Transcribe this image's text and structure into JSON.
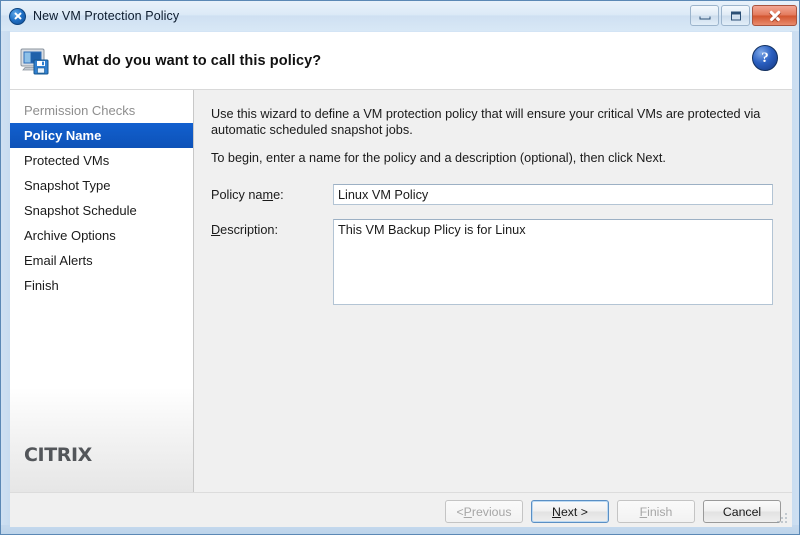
{
  "window": {
    "title": "New VM Protection Policy",
    "icon": "xen-circle-x-icon",
    "controls": {
      "minimize": "minimize-icon",
      "maximize": "maximize-icon",
      "close": "close-icon"
    }
  },
  "header": {
    "icon": "monitor-save-icon",
    "title": "What do you want to call this policy?",
    "help_label": "?"
  },
  "sidebar": {
    "items": [
      {
        "label": "Permission Checks",
        "state": "done"
      },
      {
        "label": "Policy Name",
        "state": "active"
      },
      {
        "label": "Protected VMs",
        "state": "normal"
      },
      {
        "label": "Snapshot Type",
        "state": "normal"
      },
      {
        "label": "Snapshot Schedule",
        "state": "normal"
      },
      {
        "label": "Archive Options",
        "state": "normal"
      },
      {
        "label": "Email Alerts",
        "state": "normal"
      },
      {
        "label": "Finish",
        "state": "normal"
      }
    ],
    "brand": "CITRIX"
  },
  "content": {
    "intro_paragraph_1": "Use this wizard to define a VM protection policy that will ensure your critical VMs are protected via automatic scheduled snapshot jobs.",
    "intro_paragraph_2": "To begin, enter a name for the policy and a description (optional), then click Next.",
    "policy_name": {
      "label_before": "Policy na",
      "label_accel": "m",
      "label_after": "e:",
      "value": "Linux VM Policy",
      "placeholder": ""
    },
    "description": {
      "label_accel": "D",
      "label_after": "escription:",
      "value": "This VM Backup Plicy is for Linux",
      "placeholder": ""
    }
  },
  "footer": {
    "buttons": [
      {
        "name": "previous",
        "before": "< ",
        "accel": "P",
        "after": "revious",
        "state": "disabled"
      },
      {
        "name": "next",
        "before": "",
        "accel": "N",
        "after": "ext >",
        "state": "default"
      },
      {
        "name": "finish",
        "before": "",
        "accel": "F",
        "after": "inish",
        "state": "disabled"
      },
      {
        "name": "cancel",
        "before": "",
        "accel": "",
        "after": "Cancel",
        "state": "normal"
      }
    ]
  },
  "colors": {
    "accent_blue": "#0d52b8",
    "window_frame": "#cfe0f2",
    "content_bg": "#f0f0f0",
    "citrix_gray": "#53565a",
    "close_red": "#d2552f"
  }
}
